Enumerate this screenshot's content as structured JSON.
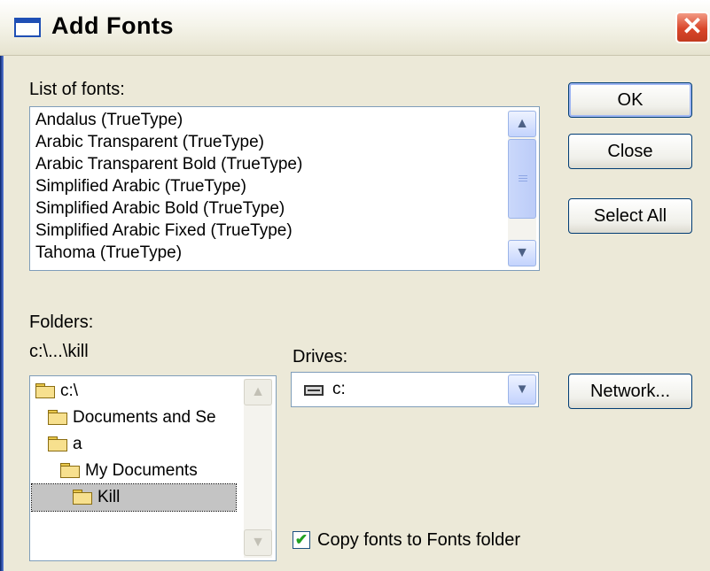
{
  "window": {
    "title": "Add Fonts",
    "close_glyph": "✕"
  },
  "font_list": {
    "label": "List of fonts:",
    "items": [
      "Andalus (TrueType)",
      "Arabic Transparent (TrueType)",
      "Arabic Transparent Bold (TrueType)",
      "Simplified Arabic (TrueType)",
      "Simplified Arabic Bold (TrueType)",
      "Simplified Arabic Fixed (TrueType)",
      "Tahoma (TrueType)"
    ]
  },
  "buttons": {
    "ok": "OK",
    "close": "Close",
    "select_all": "Select All",
    "network": "Network..."
  },
  "folders": {
    "label": "Folders:",
    "path": "c:\\...\\kill",
    "tree": [
      "c:\\",
      "Documents and Se",
      "a",
      "My Documents",
      "Kill"
    ]
  },
  "drives": {
    "label": "Drives:",
    "value": "c:"
  },
  "copy_option": {
    "label": "Copy fonts to Fonts folder",
    "checked": true
  },
  "icons": [
    "window-icon",
    "close-icon",
    "folder-icon",
    "open-folder-icon",
    "drive-icon",
    "scroll-up-icon",
    "scroll-down-icon",
    "dropdown-arrow-icon",
    "checkmark-icon"
  ]
}
